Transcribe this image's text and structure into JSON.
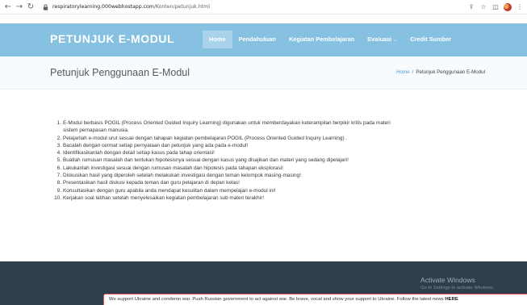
{
  "browser": {
    "url_host": "respiratorylearning.000webhostapp.com",
    "url_path": "/Konten/petunjuk.html",
    "icons": [
      "back-arrow",
      "forward-arrow",
      "reload",
      "lock",
      "share",
      "star",
      "sidebar",
      "profile",
      "more"
    ]
  },
  "header": {
    "logo": "PETUNJUK E-MODUL",
    "menu": [
      {
        "label": "Home",
        "active": true
      },
      {
        "label": "Pendahuluan",
        "active": false
      },
      {
        "label": "Kegiatan Pembelajaran",
        "active": false
      },
      {
        "label": "Evaluasi",
        "active": false,
        "dropdown": true
      },
      {
        "label": "Credit Sumber",
        "active": false
      }
    ]
  },
  "breadcrumb_bar": {
    "title": "Petunjuk Penggunaan E-Modul",
    "home": "Home",
    "separator": "/",
    "current": "Petunjuk Penggunaan E-Modul"
  },
  "instructions": [
    {
      "n": "1.",
      "text": "E-Modul berbasis POGIL (Process Oriented Guided Inquiry Learning) digunakan untuk memberdayakan keterampilan berpikir kritis pada materi"
    },
    {
      "n": "",
      "text": "sistem pernapasan manusia."
    },
    {
      "n": "2.",
      "text": "Pelajarilah e-modul urut sesuai dengan tahapan kegiatan pembelajaran POGIL (Process Oriented Guided Inquiry Learning) ."
    },
    {
      "n": "3.",
      "text": "Bacalah dengan cermat setiap pernyataan dan petunjuk yang ada pada e-modul!"
    },
    {
      "n": "4.",
      "text": "Identifikasikanlah dengan detail setiap kasus pada tahap orientasi!"
    },
    {
      "n": "5.",
      "text": "Buatlah rumusan masalah dan tentukan hipotesisnya sesuai dengan kasus yang disajikan dan materi yang sedang dipelajari!"
    },
    {
      "n": "6.",
      "text": "Lakukanlah investigasi sesuai dengan rumusan masalah dan hipotesis pada tahapan eksplorasi!"
    },
    {
      "n": "7.",
      "text": "Diskusikan hasil yang diperoleh setelah melakukan investigasi dengan teman kelompok masing-masing!"
    },
    {
      "n": "8.",
      "text": "Presentasikan hasil diskusi kepada teman dan guru pelajaran di depan kelas!"
    },
    {
      "n": "9.",
      "text": "Konsultasikan dengan guru apabila anda mendapat kesulitan dalam mempelajari e-modul ini!"
    },
    {
      "n": "10.",
      "text": "Kerjakan soal latihan setelah menyelesaikan kegiatan pembelajaran sub materi terakhir!"
    }
  ],
  "watermark": {
    "title": "Activate Windows",
    "subtitle": "Go to Settings to activate Windows."
  },
  "banner": {
    "text": "We support Ukraine and condemn war. Push Russian government to act against war. Be brave, vocal and show your support to Ukraine. Follow the latest news ",
    "link": "HERE"
  },
  "colors": {
    "header_bg": "#87c1e1",
    "active_menu_bg": "#a9d3ea",
    "footer_bg": "#2e3e4b",
    "banner_border": "#e85a5a"
  }
}
